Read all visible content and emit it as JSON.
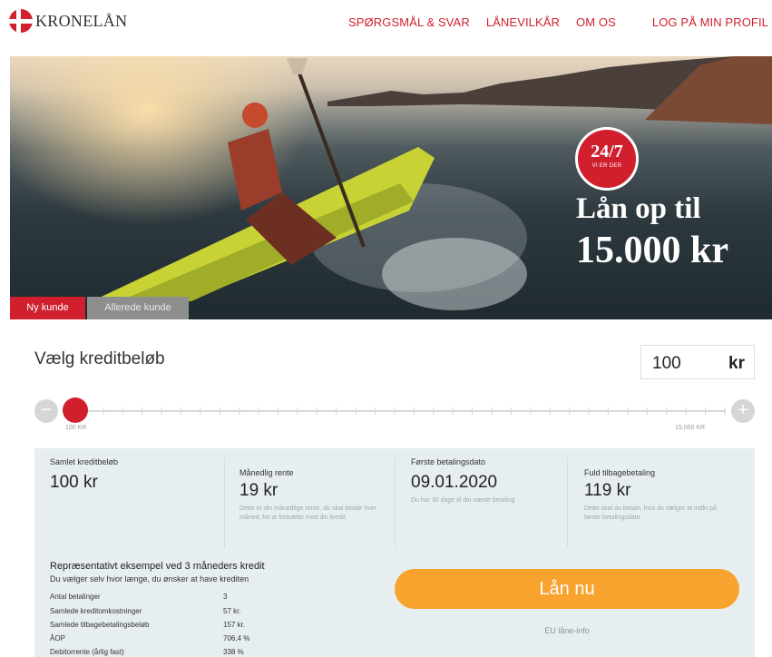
{
  "header": {
    "brand": "KRONELÅN",
    "nav": [
      "SPØRGSMÅL & SVAR",
      "LÅNEVILKÅR",
      "OM OS",
      "LOG PÅ MIN PROFIL"
    ]
  },
  "hero": {
    "badge_main": "24/7",
    "badge_sub": "VI ER DER",
    "headline_line1": "Lån op til",
    "headline_line2": "15.000 kr"
  },
  "tabs": {
    "new_customer": "Ny kunde",
    "existing_customer": "Allerede kunde"
  },
  "calculator": {
    "title": "Vælg kreditbeløb",
    "amount_value": "100",
    "amount_unit": "kr",
    "slider_minus": "−",
    "slider_plus": "+",
    "slider_min_label": "100 KR",
    "slider_max_label": "15.000 KR",
    "slider_level": 0
  },
  "summary": [
    {
      "label": "Samlet kreditbeløb",
      "value": "100 kr",
      "note": ""
    },
    {
      "label": "Månedlig rente",
      "value": "19 kr",
      "note": "Dette er din månedlige rente, du skal betale hver måned, for at fortsætte med din kredit."
    },
    {
      "label": "Første betalingsdato",
      "value": "09.01.2020",
      "note": "Du har 30 dage til din næste betaling"
    },
    {
      "label": "Fuld tilbagebetaling",
      "value": "119 kr",
      "note": "Dette skal du betale, hvis du vælger at indfri på første betalingsdato"
    }
  ],
  "example": {
    "title": "Repræsentativt eksempel ved 3 måneders kredit",
    "subtitle": "Du vælger selv hvor længe, du ønsker at have krediten",
    "rows": [
      {
        "label": "Antal betalinger",
        "value": "3"
      },
      {
        "label": "Samlede kreditomkostninger",
        "value": "57 kr."
      },
      {
        "label": "Samlede tilbagebetalingsbeløb",
        "value": "157 kr."
      },
      {
        "label": "ÅOP",
        "value": "706,4 %"
      },
      {
        "label": "Debitorrente (årlig fast)",
        "value": "338 %"
      }
    ]
  },
  "cta": {
    "loan_button": "Lån nu",
    "eu_info": "EU låne-info"
  },
  "colors": {
    "brand_red": "#d0202e",
    "cta_orange": "#f8a32e",
    "panel_bg": "#e7eef0"
  }
}
